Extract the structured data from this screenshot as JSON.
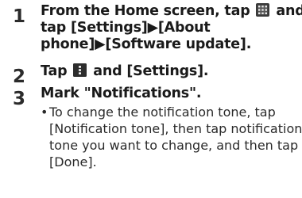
{
  "steps": [
    {
      "number": "1",
      "text_a": "From the Home screen, tap",
      "icon_1": "apps-grid-icon",
      "text_b": "and",
      "line2": "tap [Settings]▶[About",
      "line3": "phone]▶[Software update]."
    },
    {
      "number": "2",
      "text_a": "Tap",
      "icon_1": "menu-icon",
      "text_b": "and [Settings]."
    },
    {
      "number": "3",
      "text": "Mark \"Notifications\".",
      "bullet_symbol": "•",
      "bullet_lines": [
        "To change the notification tone, tap",
        "[Notification tone], then tap notification",
        "tone you want to change, and then tap",
        "[Done]."
      ]
    }
  ],
  "colors": {
    "text": "#1a1a1a",
    "icon_bg": "#2d2d2d"
  }
}
